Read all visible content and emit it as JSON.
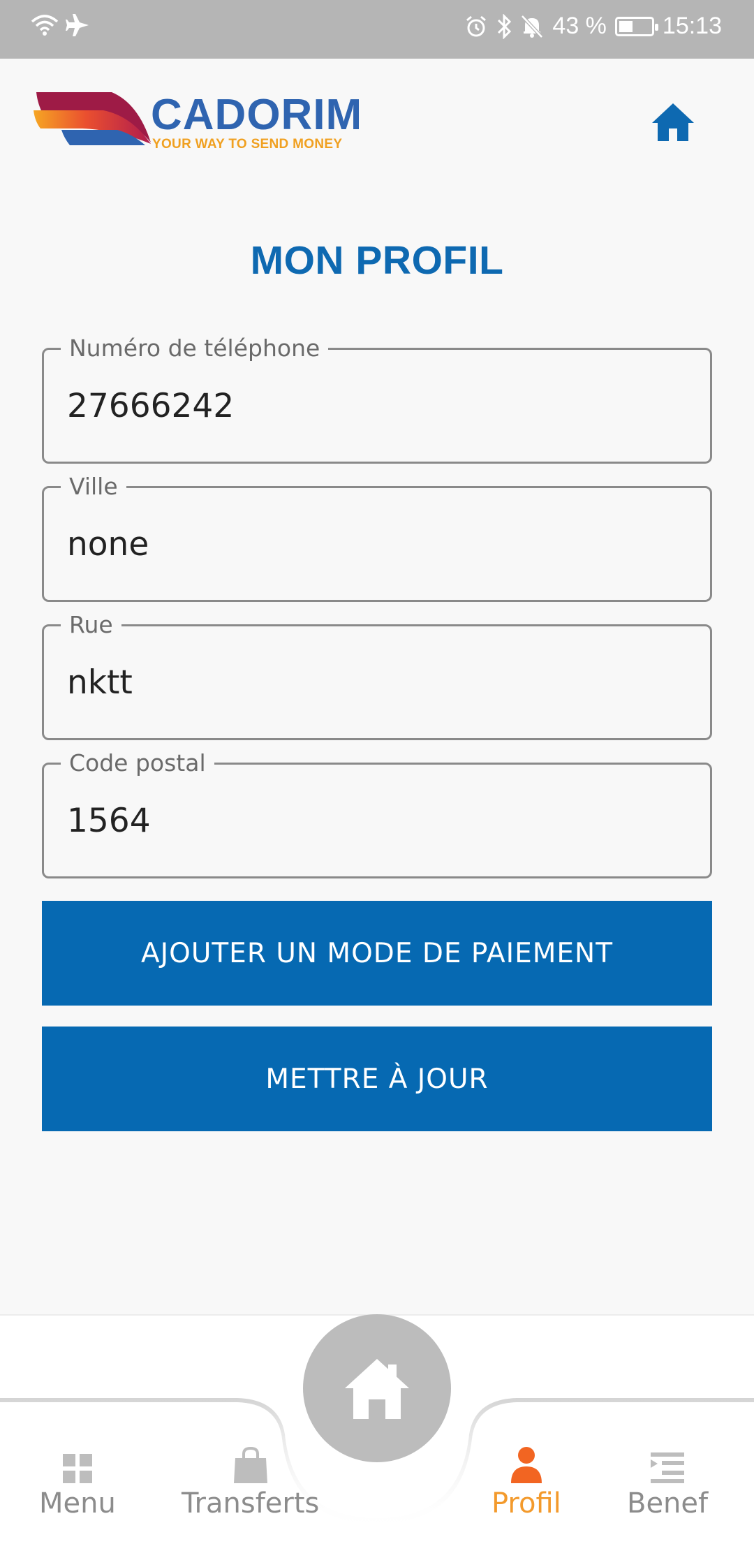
{
  "status_bar": {
    "battery": "43 %",
    "time": "15:13",
    "battery_level": 0.43
  },
  "header": {
    "logo_text": "CADORIM",
    "logo_tagline": "YOUR WAY TO SEND MONEY",
    "home_icon": "home-icon"
  },
  "page": {
    "title": "MON PROFIL"
  },
  "form": {
    "phone": {
      "label": "Numéro de téléphone",
      "value": "27666242"
    },
    "city": {
      "label": "Ville",
      "value": "none"
    },
    "street": {
      "label": "Rue",
      "value": "nktt"
    },
    "postal": {
      "label": "Code postal",
      "value": "1564"
    }
  },
  "buttons": {
    "add_payment": "AJOUTER UN MODE DE PAIEMENT",
    "update": "METTRE À JOUR"
  },
  "bottom_nav": {
    "items": [
      {
        "label": "Menu",
        "icon": "grid-icon"
      },
      {
        "label": "Transferts",
        "icon": "shopping-bag-icon"
      },
      {
        "label": "Profil",
        "icon": "user-icon"
      },
      {
        "label": "Benef",
        "icon": "list-icon"
      }
    ],
    "active_color": "#f39a2c",
    "center_icon": "home-icon"
  },
  "colors": {
    "brand_blue": "#0669b2",
    "status_bar": "#b5b5b5",
    "accent_orange": "#f39a2c"
  }
}
